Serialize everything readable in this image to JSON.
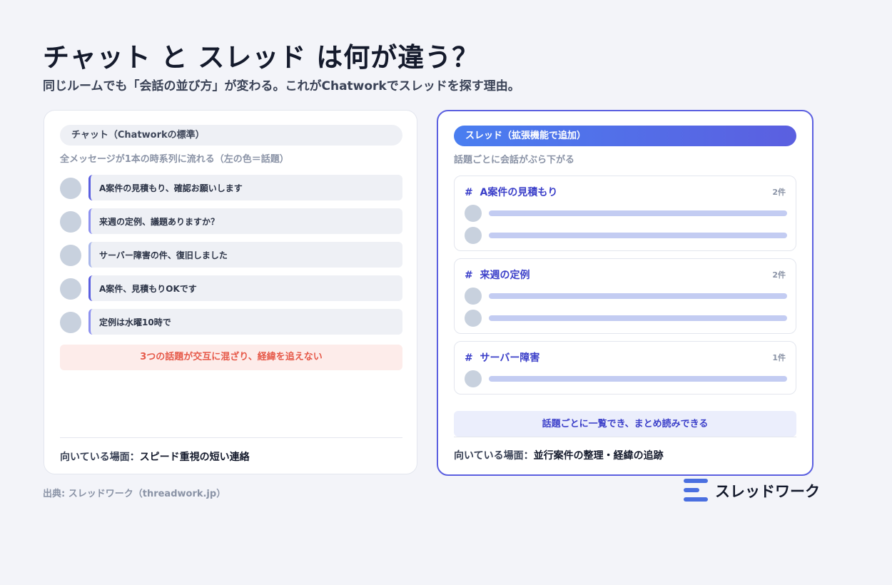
{
  "title": "チャット と スレッド は何が違う？",
  "subtitle": "同じルームでも「会話の並び方」が変わる。これがChatworkでスレッドを探す理由。",
  "chat_panel": {
    "label": "チャット（Chatworkの標準）",
    "description": "全メッセージが1本の時系列に流れる（左の色＝話題）",
    "messages": [
      {
        "text": "A案件の見積もり、確認お願いします"
      },
      {
        "text": "来週の定例、議題ありますか？"
      },
      {
        "text": "サーバー障害の件、復旧しました"
      },
      {
        "text": "A案件、見積もりOKです"
      },
      {
        "text": "定例は水曜10時で"
      }
    ],
    "warning": "3つの話題が交互に混ざり、経緯を追えない",
    "footer_label": "向いている場面：",
    "footer_value": "スピード重視の短い連絡"
  },
  "thread_panel": {
    "label": "スレッド（拡張機能で追加）",
    "description": "話題ごとに会話がぶら下がる",
    "threads": [
      {
        "hash": "#",
        "title": "A案件の見積もり",
        "count": "2件"
      },
      {
        "hash": "#",
        "title": "来週の定例",
        "count": "2件"
      },
      {
        "hash": "#",
        "title": "サーバー障害",
        "count": "1件"
      }
    ],
    "summary": "話題ごとに一覧でき、まとめ読みできる",
    "footer_label": "向いている場面：",
    "footer_value": "並行案件の整理・経緯の追跡"
  },
  "source": "出典: スレッドワーク（threadwork.jp）",
  "brand": {
    "name": "スレッドワーク",
    "icon": "threadwork-logo-icon"
  },
  "colors": {
    "accent": "#5b5fe0",
    "accent_blue": "#4a7ef0",
    "warning": "#e65a4a",
    "placeholder_bar": "#c3ccf2"
  }
}
